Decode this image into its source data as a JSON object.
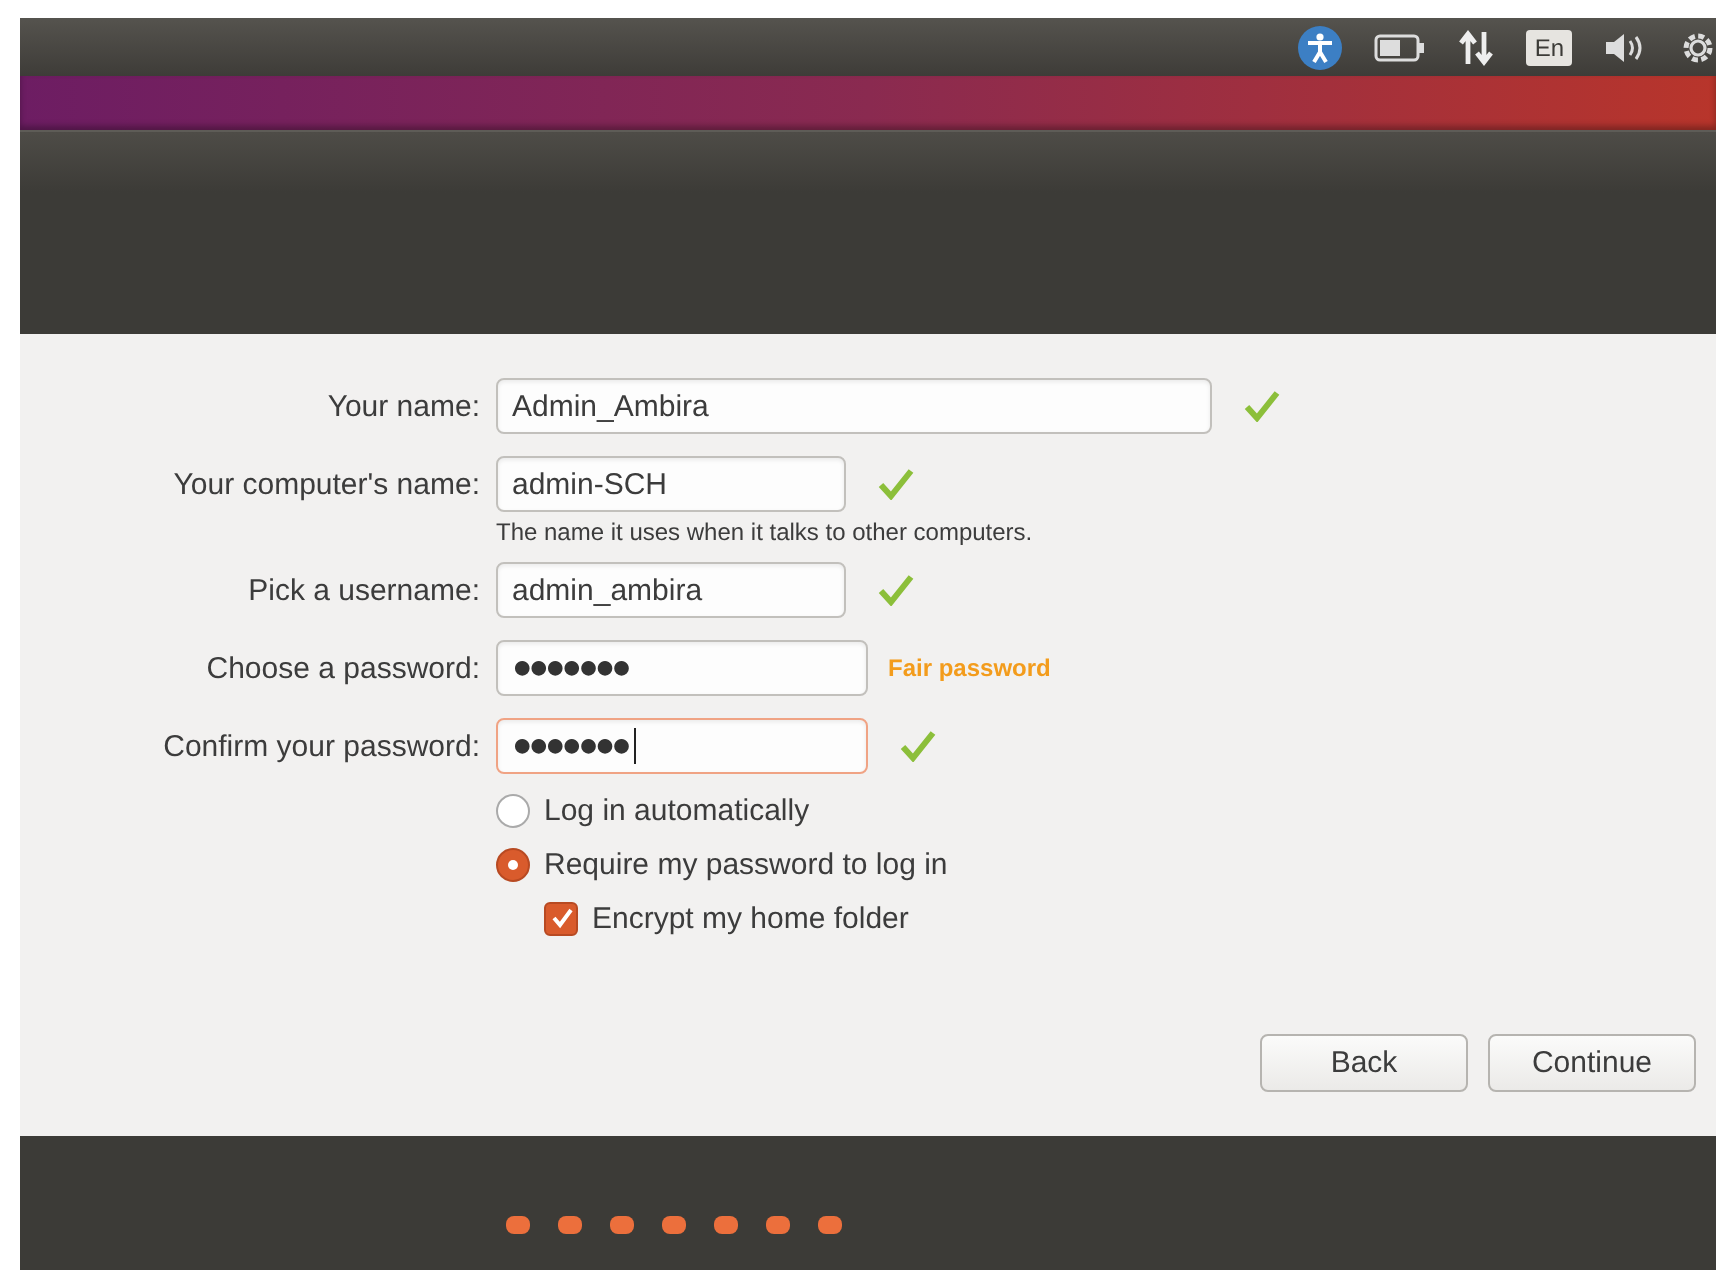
{
  "top_panel": {
    "keyboard_layout": "En"
  },
  "form": {
    "fields": [
      {
        "label": "Your name:",
        "kind": "text",
        "value": "Admin_Ambira",
        "valid": true,
        "focused": false
      },
      {
        "label": "Your computer's name:",
        "kind": "text",
        "value": "admin-SCH",
        "valid": true,
        "focused": false,
        "hint": "The name it uses when it talks to other computers."
      },
      {
        "label": "Pick a username:",
        "kind": "text",
        "value": "admin_ambira",
        "valid": true,
        "focused": false
      },
      {
        "label": "Choose a password:",
        "kind": "password",
        "value": "●●●●●●●",
        "valid": false,
        "focused": false,
        "strength": "Fair password"
      },
      {
        "label": "Confirm your password:",
        "kind": "password",
        "value": "●●●●●●●",
        "valid": true,
        "focused": true
      }
    ],
    "login_options": [
      {
        "label": "Log in automatically",
        "selected": false
      },
      {
        "label": "Require my password to log in",
        "selected": true
      }
    ],
    "encrypt": {
      "label": "Encrypt my home folder",
      "checked": true
    }
  },
  "buttons": [
    "Back",
    "Continue"
  ]
}
